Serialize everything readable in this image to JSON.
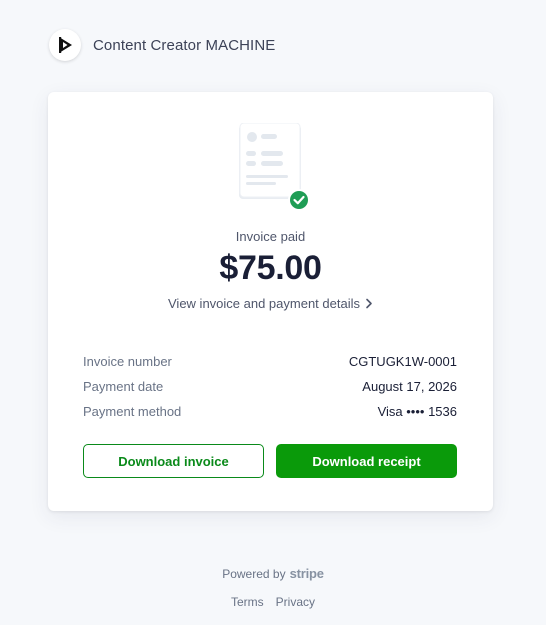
{
  "header": {
    "brand_name": "Content Creator MACHINE",
    "logo_icon": "play-logo-icon"
  },
  "card": {
    "status": "Invoice paid",
    "amount": "$75.00",
    "details_link": "View invoice and payment details",
    "rows": [
      {
        "label": "Invoice number",
        "value": "CGTUGK1W-0001"
      },
      {
        "label": "Payment date",
        "value": "August 17, 2026"
      },
      {
        "label": "Payment method",
        "value": "Visa •••• 1536"
      }
    ],
    "download_invoice": "Download invoice",
    "download_receipt": "Download receipt"
  },
  "footer": {
    "powered_by": "Powered by",
    "stripe": "stripe",
    "terms": "Terms",
    "privacy": "Privacy"
  },
  "colors": {
    "accent_green": "#0a9a0a",
    "success_badge": "#1f9d55"
  }
}
